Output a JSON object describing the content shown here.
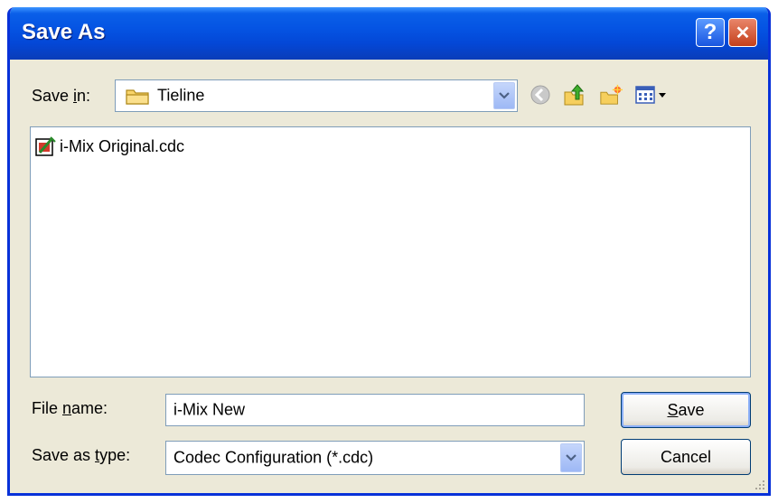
{
  "window": {
    "title": "Save As"
  },
  "titlebar_buttons": {
    "help": "?",
    "close": "✕"
  },
  "save_in": {
    "label_prefix": "Save ",
    "label_key": "i",
    "label_suffix": "n:",
    "value": "Tieline"
  },
  "files": [
    {
      "name": "i-Mix Original.cdc",
      "icon": "cdc-file-icon"
    }
  ],
  "file_name": {
    "label_prefix": "File ",
    "label_key": "n",
    "label_suffix": "ame:",
    "value": "i-Mix New"
  },
  "save_type": {
    "label_prefix": "Save as ",
    "label_key": "t",
    "label_suffix": "ype:",
    "value": "Codec Configuration (*.cdc)"
  },
  "buttons": {
    "save_key": "S",
    "save_rest": "ave",
    "cancel": "Cancel"
  },
  "colors": {
    "titlebar": "#0554e3",
    "dialog_bg": "#ece9d8",
    "border": "#7f9db9"
  }
}
